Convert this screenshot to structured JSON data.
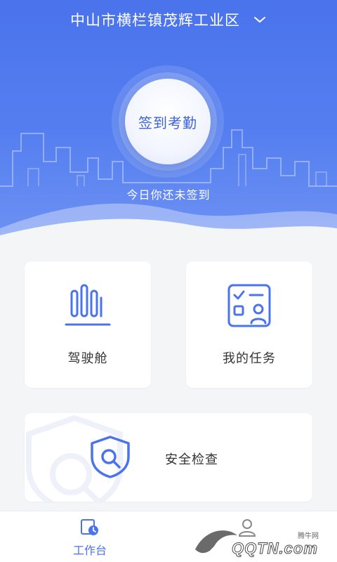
{
  "header": {
    "location": "中山市横栏镇茂辉工业区",
    "checkin_button": "签到考勤",
    "checkin_status": "今日你还未签到"
  },
  "cards": {
    "cockpit": "驾驶舱",
    "tasks": "我的任务",
    "safety": "安全检查"
  },
  "tabbar": {
    "workbench": "工作台",
    "profile": ""
  },
  "watermark": {
    "small": "腾牛网",
    "text": "QQTN.com"
  },
  "icons": {
    "location_dropdown": "chevron-down-icon",
    "cockpit": "bar-chart-icon",
    "tasks": "task-board-icon",
    "safety": "shield-search-icon",
    "workbench": "calendar-clock-icon",
    "profile": "user-icon"
  },
  "colors": {
    "primary": "#4a73ec",
    "card_bg": "#ffffff",
    "page_bg": "#f4f5f7"
  }
}
